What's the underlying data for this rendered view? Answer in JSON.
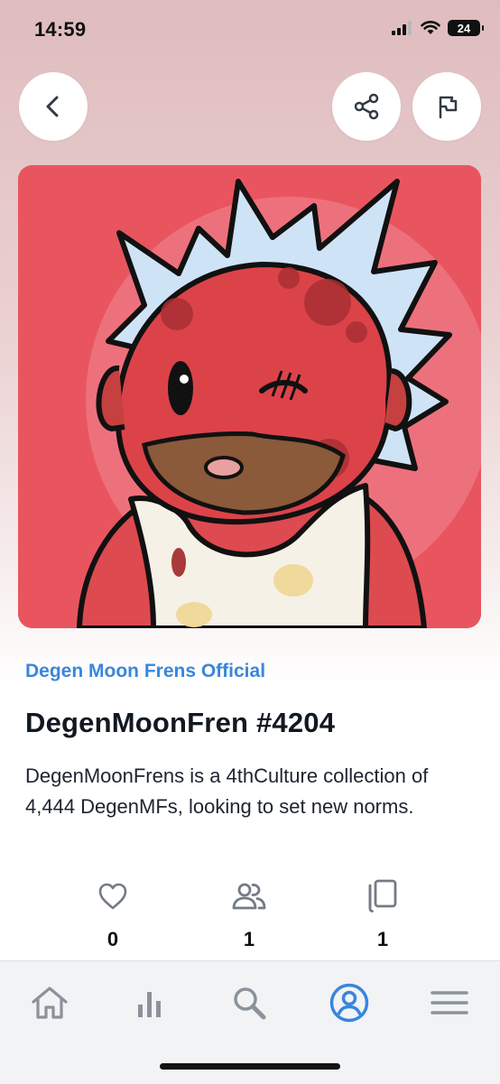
{
  "status_bar": {
    "time": "14:59",
    "battery": "24"
  },
  "header": {
    "back_icon": "chevron-left-icon",
    "share_icon": "share-icon",
    "report_icon": "flag-icon"
  },
  "nft": {
    "collection": "Degen Moon Frens Official",
    "title": "DegenMoonFren #4204",
    "description": "DegenMoonFrens is a 4thCulture collection of 4,444 DegenMFs, looking to set new norms."
  },
  "stats": [
    {
      "icon": "heart-icon",
      "value": "0"
    },
    {
      "icon": "people-icon",
      "value": "1"
    },
    {
      "icon": "copies-icon",
      "value": "1"
    }
  ],
  "tab_bar": {
    "items": [
      {
        "icon": "home-icon",
        "active": false
      },
      {
        "icon": "bar-chart-icon",
        "active": false
      },
      {
        "icon": "search-icon",
        "active": false
      },
      {
        "icon": "profile-icon",
        "active": true
      },
      {
        "icon": "menu-icon",
        "active": false
      }
    ]
  },
  "colors": {
    "accent": "#3a86dc",
    "artwork_background": "#e9555f",
    "tab_inactive": "#8a929b"
  }
}
